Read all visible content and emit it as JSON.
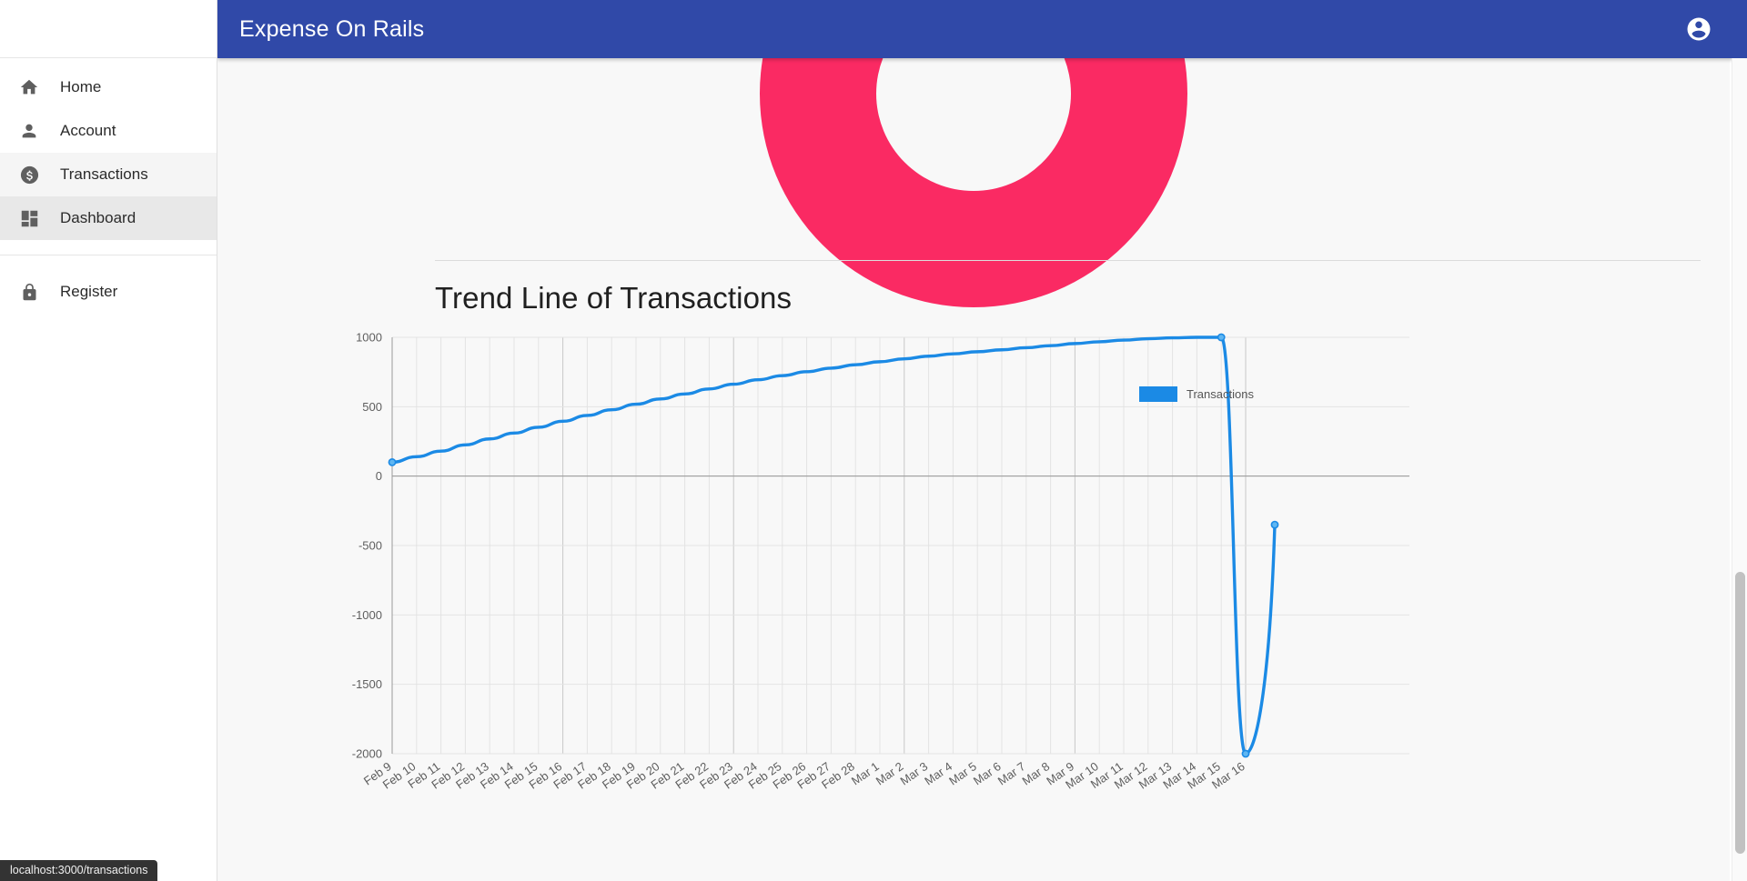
{
  "appbar": {
    "title": "Expense On Rails",
    "account_icon": "account-circle-icon"
  },
  "sidebar": {
    "items": [
      {
        "label": "Home",
        "icon": "home-icon",
        "state": "normal"
      },
      {
        "label": "Account",
        "icon": "person-icon",
        "state": "normal"
      },
      {
        "label": "Transactions",
        "icon": "dollar-circle-icon",
        "state": "hovered"
      },
      {
        "label": "Dashboard",
        "icon": "dashboard-grid-icon",
        "state": "selected"
      },
      {
        "label": "Register",
        "icon": "lock-icon",
        "state": "normal"
      }
    ]
  },
  "main": {
    "donut": {
      "name": "expense-donut-chart",
      "color": "#fa2a63"
    },
    "trend": {
      "title": "Trend Line of Transactions",
      "legend_label": "Transactions",
      "legend_color": "#1b8ae5"
    }
  },
  "statusbar": {
    "url": "localhost:3000/transactions"
  },
  "chart_data": {
    "type": "line",
    "title": "Trend Line of Transactions",
    "xlabel": "",
    "ylabel": "",
    "ylim": [
      -2000,
      1000
    ],
    "yticks": [
      1000,
      500,
      0,
      -500,
      -1000,
      -1500,
      -2000
    ],
    "grid": true,
    "legend_position": "top-right",
    "categories": [
      "Feb 9",
      "Feb 10",
      "Feb 11",
      "Feb 12",
      "Feb 13",
      "Feb 14",
      "Feb 15",
      "Feb 16",
      "Feb 17",
      "Feb 18",
      "Feb 19",
      "Feb 20",
      "Feb 21",
      "Feb 22",
      "Feb 23",
      "Feb 24",
      "Feb 25",
      "Feb 26",
      "Feb 27",
      "Feb 28",
      "Mar 1",
      "Mar 2",
      "Mar 3",
      "Mar 4",
      "Mar 5",
      "Mar 6",
      "Mar 7",
      "Mar 8",
      "Mar 9",
      "Mar 10",
      "Mar 11",
      "Mar 12",
      "Mar 13",
      "Mar 14",
      "Mar 15",
      "Mar 16"
    ],
    "series": [
      {
        "name": "Transactions",
        "color": "#1b8ae5",
        "values": [
          100,
          140,
          180,
          225,
          268,
          310,
          352,
          395,
          437,
          478,
          518,
          556,
          592,
          628,
          662,
          694,
          724,
          752,
          778,
          802,
          824,
          845,
          864,
          881,
          896,
          910,
          925,
          940,
          955,
          968,
          980,
          990,
          996,
          1000,
          1000,
          -2000
        ]
      }
    ],
    "annotations": [
      {
        "text": "final segment rebounds from -2000 to about -350 at the right edge"
      }
    ]
  }
}
